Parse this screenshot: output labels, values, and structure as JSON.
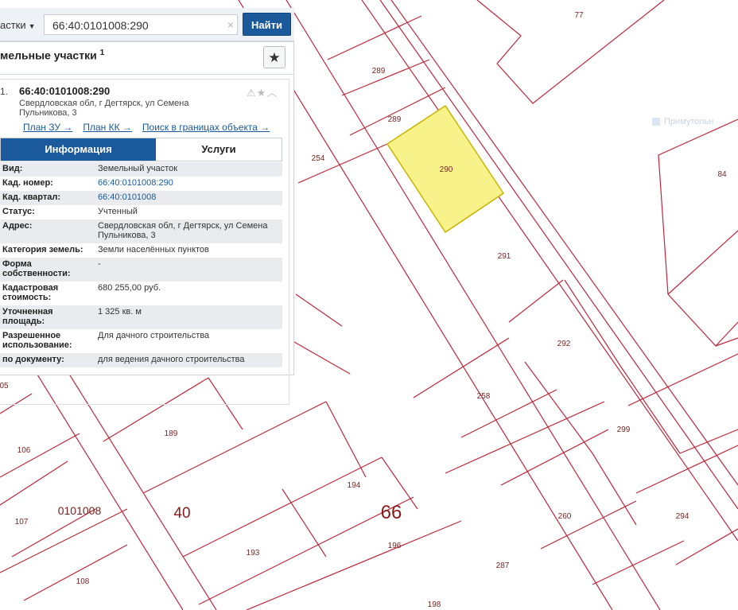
{
  "search": {
    "type_label": "астки",
    "query": "66:40:0101008:290",
    "clear_icon": "×",
    "button_label": "Найти"
  },
  "panel": {
    "title": "мельные участки",
    "title_count": "1",
    "favorite_icon": "star-icon",
    "item": {
      "number": "1.",
      "cad_number": "66:40:0101008:290",
      "address": "Свердловская обл, г Дегтярск, ул Семена Пульникова, 3",
      "links": [
        "План ЗУ →",
        "План КК →",
        "Поиск в границах объекта →"
      ],
      "tabs": [
        "Информация",
        "Услуги"
      ],
      "rows": [
        {
          "key": "Вид:",
          "value": "Земельный участок"
        },
        {
          "key": "Кад. номер:",
          "value": "66:40:0101008:290"
        },
        {
          "key": "Кад. квартал:",
          "value": "66:40:0101008"
        },
        {
          "key": "Статус:",
          "value": "Учтенный"
        },
        {
          "key": "Адрес:",
          "value": "Свердловская обл, г Дегтярск, ул Семена Пульникова, 3"
        },
        {
          "key": "Категория земель:",
          "value": "Земли населённых пунктов"
        },
        {
          "key": "Форма собственности:",
          "value": "-"
        },
        {
          "key": "Кадастровая стоимость:",
          "value": "680 255,00 руб."
        },
        {
          "key": "Уточненная площадь:",
          "value": "1 325 кв. м"
        },
        {
          "key": "Разрешенное использование:",
          "value": "Для дачного строительства"
        },
        {
          "key": "по документу:",
          "value": "для ведения дачного строительства"
        }
      ]
    }
  },
  "map": {
    "parcel_labels": [
      "77",
      "289",
      "289",
      "290",
      "254",
      "84",
      "291",
      "292",
      "258",
      "299",
      "189",
      "106",
      "0101008",
      "107",
      "40",
      "194",
      "66",
      "193",
      "196",
      "260",
      "294",
      "108",
      "287",
      "198",
      "05"
    ],
    "note": "Примутольн",
    "colors": {
      "boundary": "#c0273a",
      "selected_fill": "#f7f38a",
      "selected_stroke": "#c9b400",
      "panel_accent": "#1b5b9d"
    }
  }
}
